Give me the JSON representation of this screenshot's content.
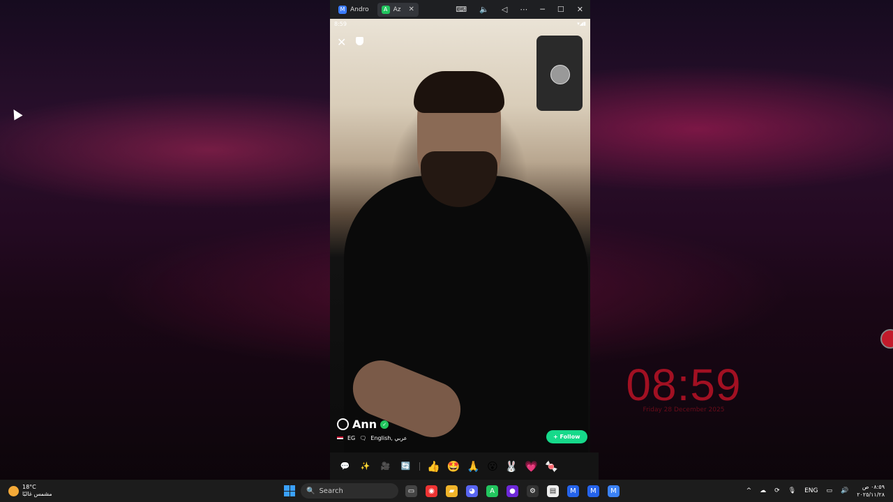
{
  "emulator": {
    "tabs": [
      {
        "label": "Andro",
        "icon": "app-icon"
      },
      {
        "label": "Az",
        "icon": "azar-icon"
      }
    ],
    "window_controls": [
      "keyboard-icon",
      "volume-icon",
      "back-icon",
      "more-icon",
      "minimize-icon",
      "maximize-icon",
      "close-icon"
    ]
  },
  "phone": {
    "status_time": "8:59",
    "profile": {
      "name": "Ann",
      "country": "EG",
      "languages": "English, عربي"
    },
    "follow_label": "+ Follow"
  },
  "desktop_clock": {
    "time": "08:59",
    "date": "Friday 28 December 2025"
  },
  "taskbar": {
    "weather_temp": "18°C",
    "weather_desc": "مشمس غالبًا",
    "search_placeholder": "Search",
    "language": "ENG",
    "clock_time": "٠٨:٥٩ ص",
    "clock_date": "٢٠٢٥/١١/٢٨"
  }
}
